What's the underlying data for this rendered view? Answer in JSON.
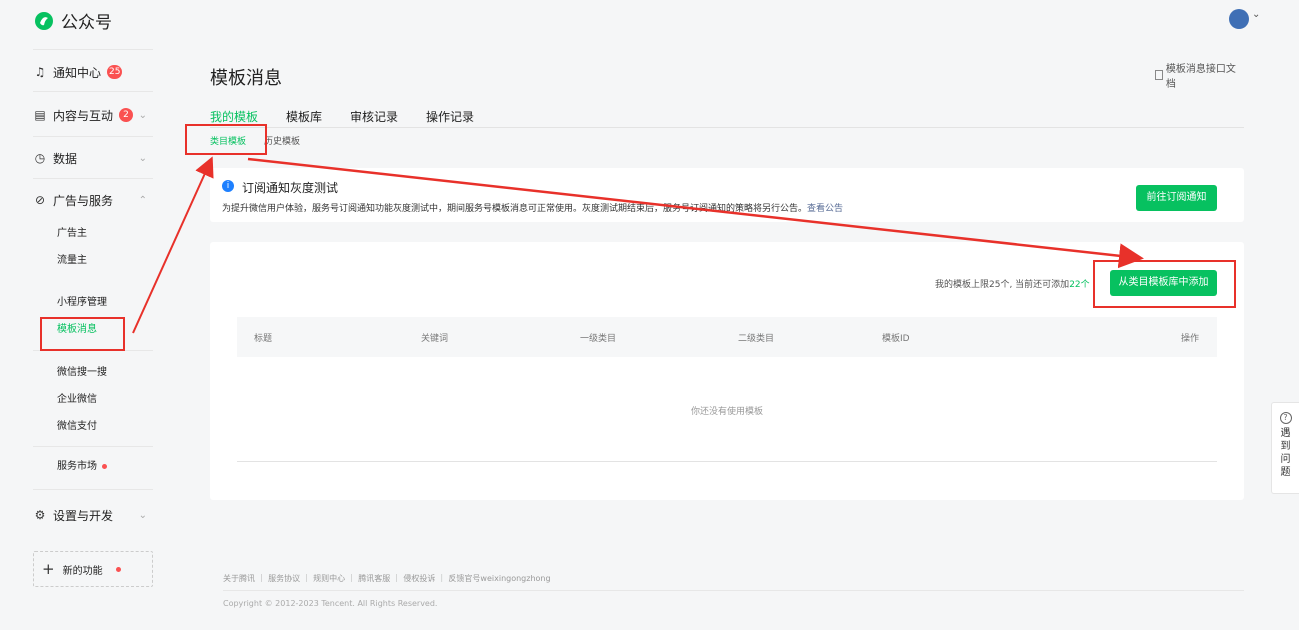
{
  "header": {
    "title": "公众号",
    "avatar_chevron": "⌄"
  },
  "sidebar": {
    "notice": {
      "label": "通知中心",
      "badge": "25",
      "icon": "bell-icon"
    },
    "content": {
      "label": "内容与互动",
      "badge": "2",
      "icon": "document-icon"
    },
    "data": {
      "label": "数据",
      "icon": "clock-icon"
    },
    "ads": {
      "label": "广告与服务",
      "icon": "compass-icon"
    },
    "ads_items": [
      "广告主",
      "流量主",
      "小程序管理",
      "模板消息",
      "微信搜一搜",
      "企业微信",
      "微信支付",
      "服务市场"
    ],
    "settings": {
      "label": "设置与开发",
      "icon": "gear-icon"
    },
    "new_func": {
      "label": "新的功能",
      "icon": "plus-icon"
    }
  },
  "main": {
    "title": "模板消息",
    "doc_link": "模板消息接口文档",
    "tabs": [
      "我的模板",
      "模板库",
      "审核记录",
      "操作记录"
    ],
    "subtabs": [
      "类目模板",
      "历史模板"
    ],
    "notice": {
      "title": "订阅通知灰度测试",
      "text": "为提升微信用户体验，服务号订阅通知功能灰度测试中，期间服务号模板消息可正常使用。灰度测试期结束后，服务号订阅通知的策略将另行公告。",
      "link": "查看公告",
      "button": "前往订阅通知"
    },
    "limit_prefix": "我的模板上限25个, 当前还可添加",
    "limit_count": "22个",
    "add_button": "从类目模板库中添加",
    "columns": [
      "标题",
      "关键词",
      "一级类目",
      "二级类目",
      "模板ID",
      "操作"
    ],
    "empty_text": "你还没有使用模板"
  },
  "footer": {
    "links": "关于腾讯 ｜ 服务协议 ｜ 规则中心 ｜ 腾讯客服 ｜ 侵权投诉 ｜ 反馈官号weixingongzhong",
    "copyright": "Copyright © 2012-2023 Tencent. All Rights Reserved."
  },
  "help": {
    "icon_text": "?",
    "label": "遇到问题"
  },
  "colors": {
    "accent": "#07c160",
    "annotation": "#e8312a",
    "badge": "#fa5151"
  }
}
